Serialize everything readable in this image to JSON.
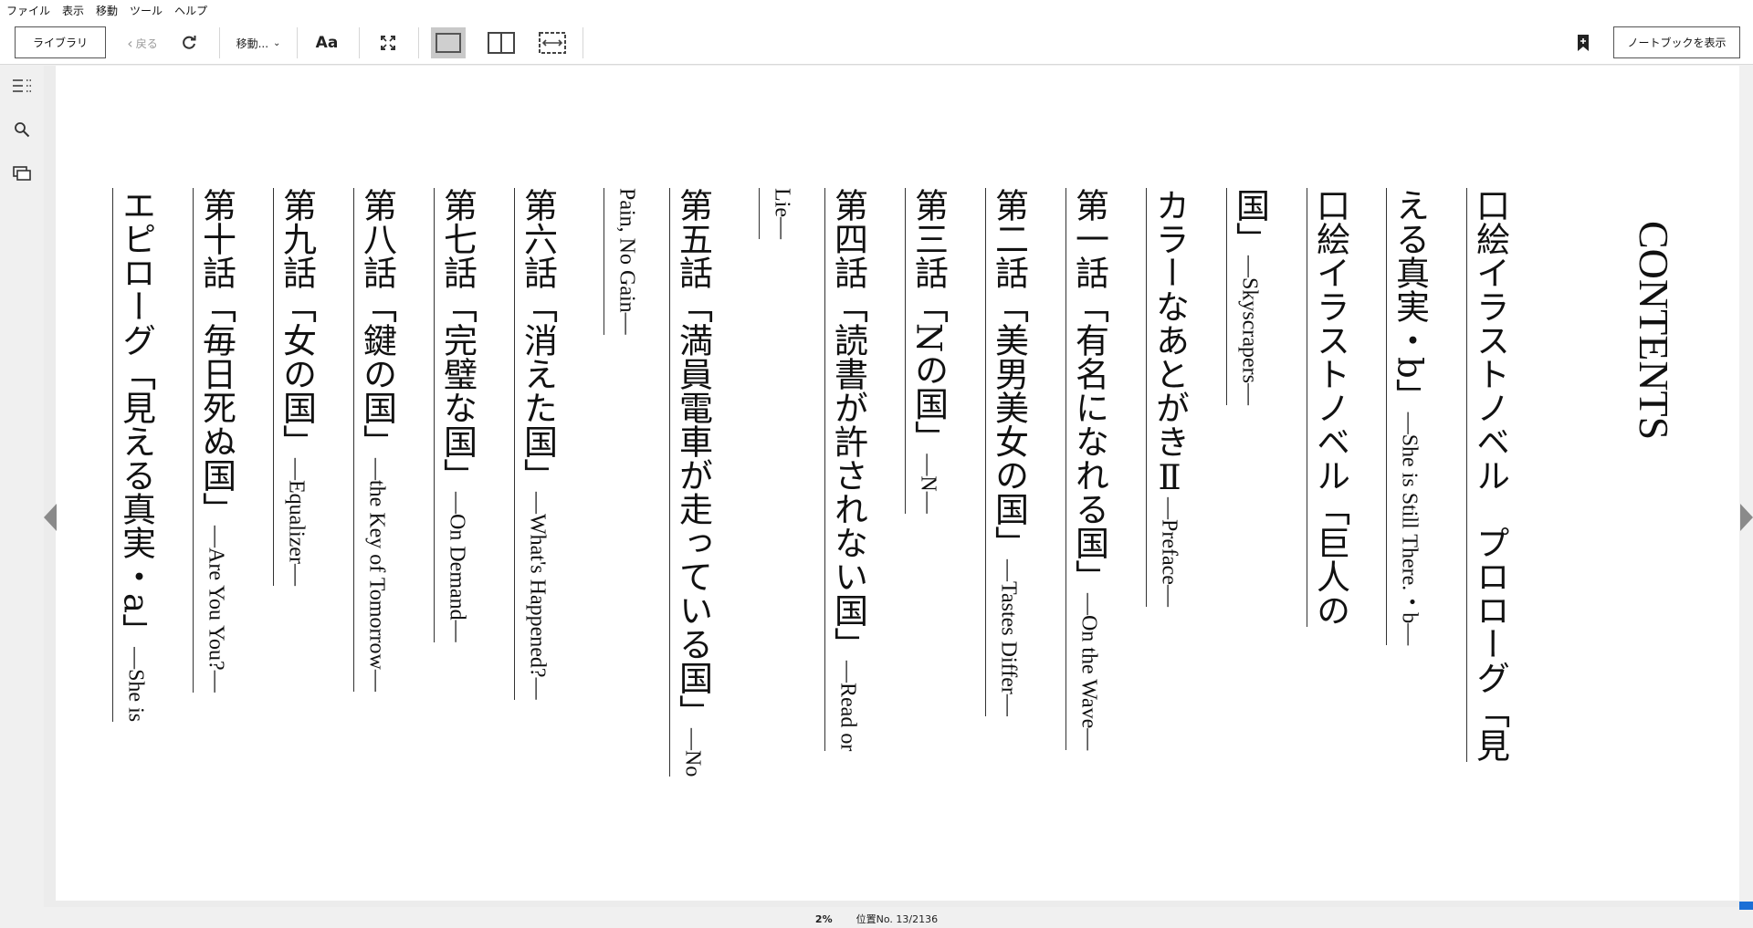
{
  "menu": [
    "ファイル",
    "表示",
    "移動",
    "ツール",
    "ヘルプ"
  ],
  "toolbar": {
    "library": "ライブラリ",
    "back": "戻る",
    "move": "移動...",
    "font": "Aa",
    "notebook": "ノートブックを表示"
  },
  "book": {
    "title": "CONTENTS",
    "entries": [
      {
        "ja": "口絵イラストノベル　プロローグ「見",
        "en": ""
      },
      {
        "ja": "える真実・b」",
        "en": "—She is Still There.・b—"
      },
      {
        "ja": "口絵イラストノベル「巨人の",
        "en": ""
      },
      {
        "ja": "国」",
        "en": "—Skyscrapers—"
      },
      {
        "ja": "カラーなあとがきⅡ",
        "en": "—Preface—"
      },
      {
        "ja": "第一話「有名になれる国」",
        "en": "—On the Wave—"
      },
      {
        "ja": "第二話「美男美女の国」",
        "en": "—Tastes Differ—"
      },
      {
        "ja": "第三話「Nの国」",
        "en": "—N—"
      },
      {
        "ja": "第四話「読書が許されない国」",
        "en": "—Read or"
      },
      {
        "ja": "",
        "en": "Lie—"
      },
      {
        "ja": "第五話「満員電車が走っている国」",
        "en": "—No"
      },
      {
        "ja": "",
        "en": "Pain, No Gain—"
      },
      {
        "ja": "第六話「消えた国」",
        "en": "—What's Happened?—"
      },
      {
        "ja": "第七話「完璧な国」",
        "en": "—On Demand—"
      },
      {
        "ja": "第八話「鍵の国」",
        "en": "—the Key of Tomorrow—"
      },
      {
        "ja": "第九話「女の国」",
        "en": "—Equalizer—"
      },
      {
        "ja": "第十話「毎日死ぬ国」",
        "en": "—Are You You?—"
      },
      {
        "ja": "エピローグ「見える真実・a」",
        "en": "—She is"
      }
    ]
  },
  "status": {
    "percent": "2%",
    "location": "位置No. 13/2136"
  }
}
